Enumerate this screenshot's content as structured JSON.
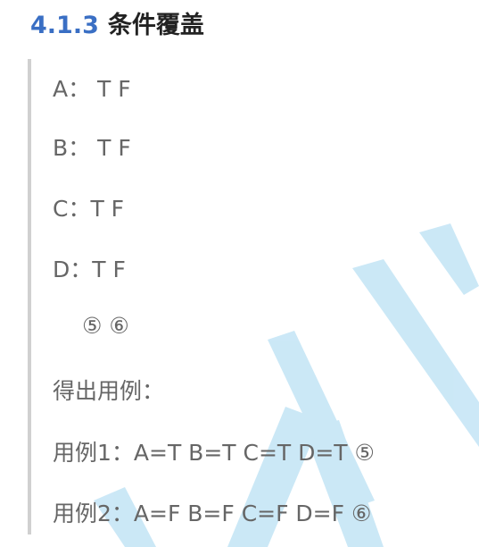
{
  "heading": {
    "number": "4.1.3",
    "title": "条件覆盖"
  },
  "lines": [
    "A： T F",
    "B： T F",
    "C：T F",
    "D：T F",
    "⑤ ⑥",
    "得出用例：",
    "用例1：A=T B=T  C=T D=T ⑤",
    "用例2：A=F B=F  C=F D=F  ⑥"
  ],
  "colors": {
    "accent": "#3a6fc4",
    "text": "#666666",
    "bar": "#d0d0d0",
    "watermark": "#bfe3f5"
  }
}
